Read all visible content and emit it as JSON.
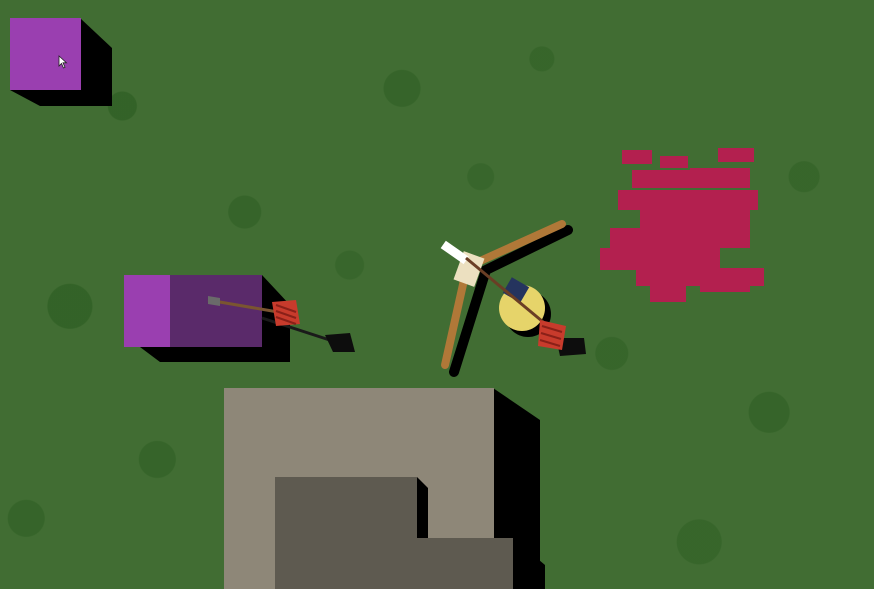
{
  "scene": {
    "ground_color": "#416d33",
    "crate_color_light": "#9a3fb0",
    "crate_color_dark": "#5a2a6a",
    "stone_color_light": "#8e8778",
    "stone_color_dark": "#5e5a50",
    "blood_color": "#b3204f",
    "bow_color": "#b07838",
    "player_color": "#e6d46a",
    "arrow_fletching_color": "#c83b2c"
  },
  "entities": {
    "crate_top_left": "purple-crate",
    "crate_mid_left": "purple-crate",
    "stone_block": "stone-block",
    "player": "archer-player",
    "bow": "bow",
    "arrow_stuck": "arrow",
    "arrow_nocked": "arrow",
    "blood_splatter": "blood-splatter",
    "cursor": "mouse-cursor-icon"
  }
}
